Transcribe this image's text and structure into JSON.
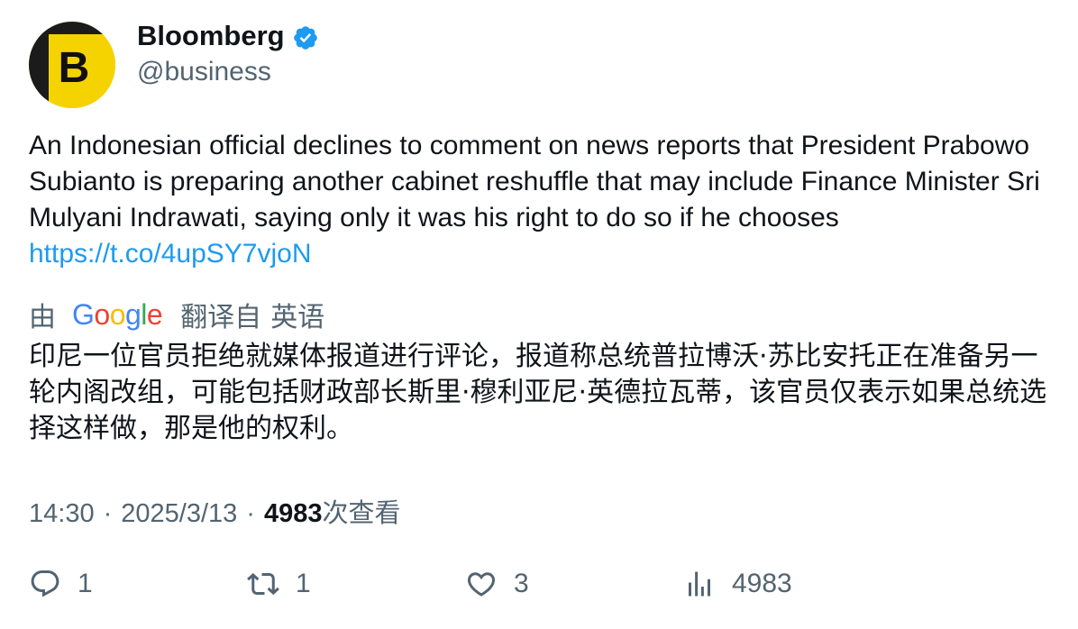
{
  "author": {
    "name": "Bloomberg",
    "handle": "@business",
    "avatar_letter": "B",
    "verified": true
  },
  "tweet": {
    "text": "An Indonesian official declines to comment on news reports that President Prabowo Subianto is preparing another cabinet reshuffle that may include Finance Minister Sri Mulyani Indrawati, saying only it was his right to do so if he chooses",
    "link": "https://t.co/4upSY7vjoN"
  },
  "translation": {
    "by_label": "由",
    "provider_label": "Google",
    "from_label": "翻译自",
    "language": "英语",
    "text": "印尼一位官员拒绝就媒体报道进行评论，报道称总统普拉博沃·苏比安托正在准备另一轮内阁改组，可能包括财政部长斯里·穆利亚尼·英德拉瓦蒂，该官员仅表示如果总统选择这样做，那是他的权利。"
  },
  "meta": {
    "time": "14:30",
    "date": "2025/3/13",
    "separator": "·",
    "views_count": "4983",
    "views_label": "次查看"
  },
  "actions": {
    "replies": "1",
    "retweets": "1",
    "likes": "3",
    "views": "4983"
  },
  "colors": {
    "link": "#1d9bf0",
    "secondary_text": "#536471",
    "verified_badge": "#1d9bf0",
    "avatar_yellow": "#f5d300"
  }
}
